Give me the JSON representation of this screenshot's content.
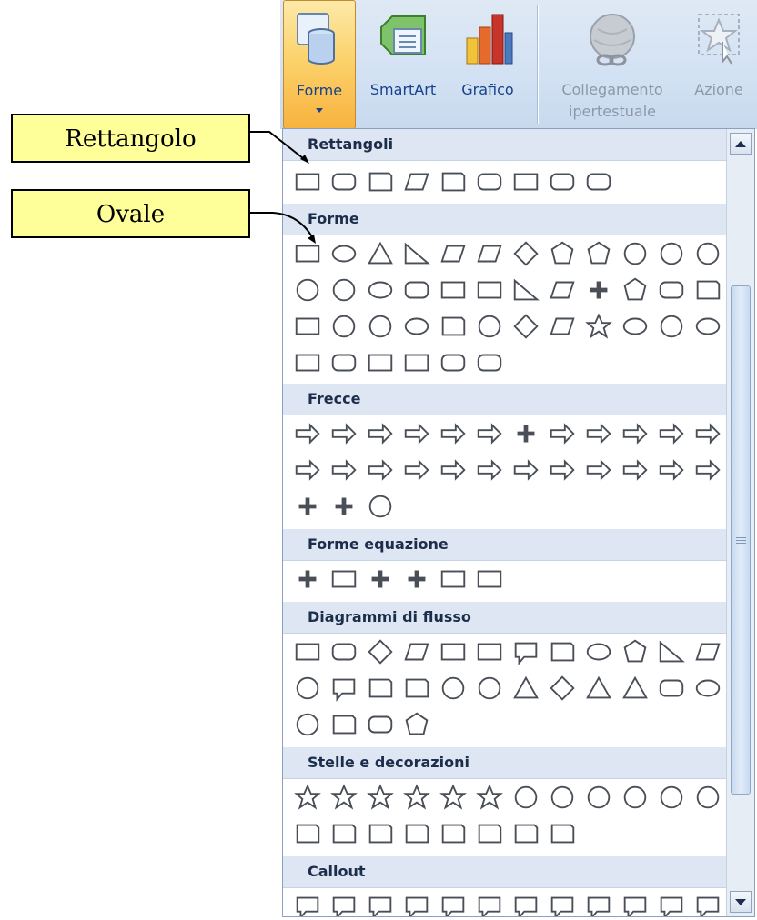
{
  "ribbon": {
    "buttons": [
      {
        "label": "Forme",
        "icon": "shapes-icon",
        "state": "active"
      },
      {
        "label": "SmartArt",
        "icon": "smartart-icon",
        "state": "normal"
      },
      {
        "label": "Grafico",
        "icon": "chart-icon",
        "state": "normal"
      },
      {
        "label": "Collegamento",
        "label2": "ipertestuale",
        "icon": "hyperlink-icon",
        "state": "disabled"
      },
      {
        "label": "Azione",
        "icon": "action-icon",
        "state": "disabled"
      }
    ]
  },
  "gallery": {
    "sections": [
      {
        "title": "Rettangoli",
        "count": 9
      },
      {
        "title": "Forme",
        "count": 44
      },
      {
        "title": "Frecce",
        "count": 31
      },
      {
        "title": "Forme equazione",
        "count": 6
      },
      {
        "title": "Diagrammi di flusso",
        "count": 28
      },
      {
        "title": "Stelle e decorazioni",
        "count": 20
      },
      {
        "title": "Callout",
        "count": 13
      }
    ]
  },
  "callouts": [
    {
      "label": "Rettangolo"
    },
    {
      "label": "Ovale"
    }
  ],
  "colors": {
    "shape_stroke": "#4a4f57",
    "accent": "#fbd36d",
    "header_text": "#1c2e4c"
  }
}
